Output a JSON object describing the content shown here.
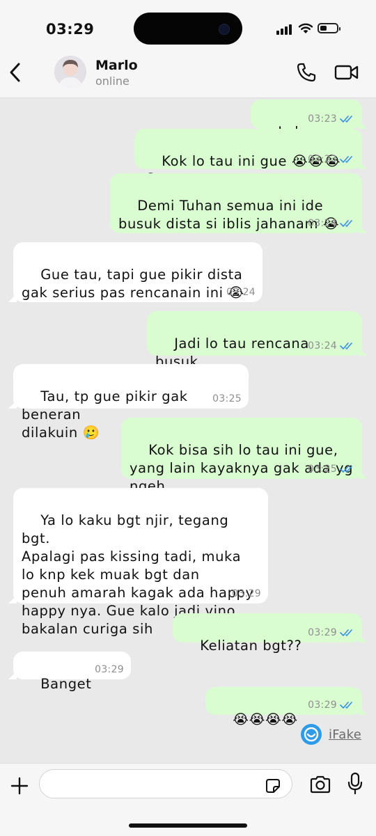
{
  "status_bar": {
    "time": "03:29"
  },
  "header": {
    "contact_name": "Marlo",
    "contact_status": "online"
  },
  "messages": [
    {
      "dir": "out",
      "text": "Lah",
      "time": "03:23",
      "read": true
    },
    {
      "dir": "out",
      "text": "Kok lo tau ini gue 😭😭😭😭",
      "time": "03:23",
      "read": true
    },
    {
      "dir": "out",
      "text": "Demi Tuhan semua ini ide\nbusuk dista si iblis jahanam 😭",
      "time": "03:24",
      "read": true
    },
    {
      "dir": "in",
      "text": "Gue tau, tapi gue pikir dista\ngak serius pas rencanain ini 😭",
      "time": "03:24"
    },
    {
      "dir": "out",
      "text": "Jadi lo tau rencana busuk\ndia????",
      "time": "03:24",
      "read": true
    },
    {
      "dir": "in",
      "text": "Tau, tp gue pikir gak beneran\ndilakuin 🥲",
      "time": "03:25"
    },
    {
      "dir": "out",
      "text": "Kok bisa sih lo tau ini gue,\nyang lain kayaknya gak ada yg\nngeh",
      "time": "03:25",
      "read": true
    },
    {
      "dir": "in",
      "text": "Ya lo kaku bgt njir, tegang bgt.\nApalagi pas kissing tadi, muka\nlo knp kek muak bgt dan\npenuh amarah kagak ada happy\nhappy nya. Gue kalo jadi vino\nbakalan curiga sih",
      "time": "03:29"
    },
    {
      "dir": "out",
      "text": "Keliatan bgt??",
      "time": "03:29",
      "read": true
    },
    {
      "dir": "in",
      "text": "Banget",
      "time": "03:29"
    },
    {
      "dir": "out",
      "text": "😭😭😭😭",
      "time": "03:29",
      "read": true
    }
  ],
  "watermark": {
    "label": "iFake"
  },
  "composer": {
    "placeholder": ""
  },
  "colors": {
    "outgoing": "#d9fdd0",
    "incoming": "#ffffff",
    "read_ticks": "#3a8ee6"
  }
}
